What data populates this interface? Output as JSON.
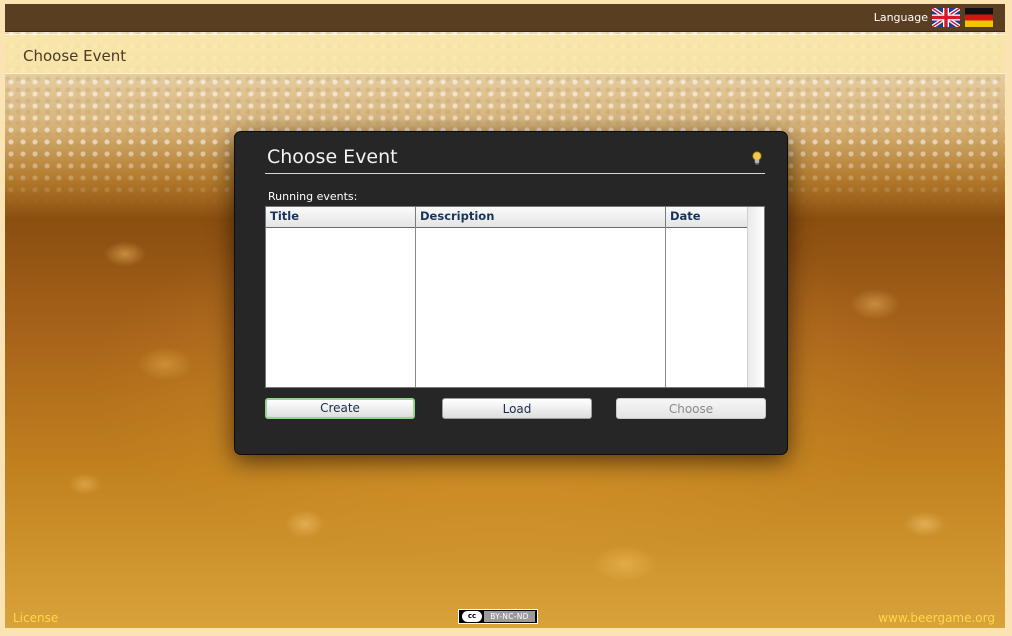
{
  "topbar": {
    "language_label": "Language",
    "flags": [
      {
        "name": "uk-flag-icon",
        "lang": "English"
      },
      {
        "name": "german-flag-icon",
        "lang": "Deutsch"
      }
    ]
  },
  "subheader": {
    "title": "Choose Event"
  },
  "dialog": {
    "title": "Choose Event",
    "help_icon": "lightbulb-icon",
    "running_label": "Running events:",
    "table": {
      "columns": [
        "Title",
        "Description",
        "Date"
      ],
      "rows": []
    },
    "buttons": {
      "create": "Create",
      "load": "Load",
      "choose": "Choose"
    }
  },
  "footer": {
    "license": "License",
    "cc_logo": "cc",
    "cc_badge": "BY-NC-ND",
    "site": "www.beergame.org"
  },
  "colors": {
    "topbar": "#5a3e21",
    "dialog_bg": "#262626",
    "footer_link": "#ffd84a",
    "create_focus": "#8fd98f"
  }
}
